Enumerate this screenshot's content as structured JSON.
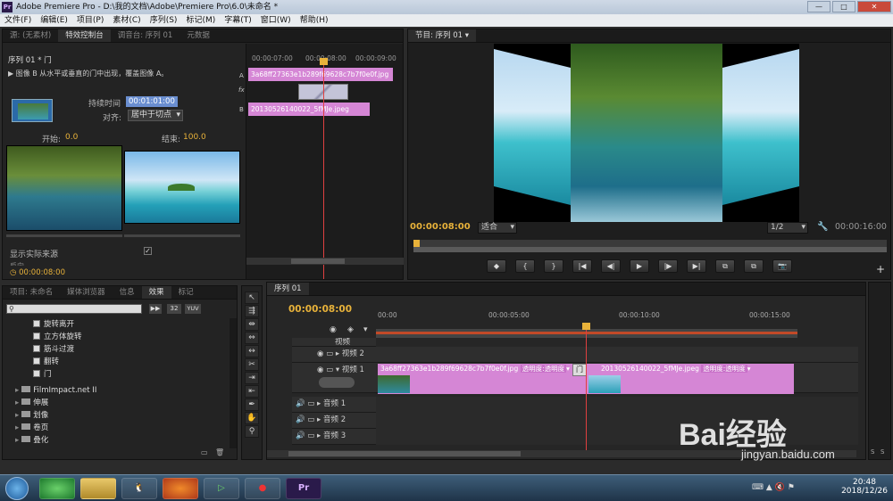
{
  "window": {
    "title": "Adobe Premiere Pro - D:\\我的文档\\Adobe\\Premiere Pro\\6.0\\未命名 *",
    "logo": "Pr",
    "buttons": [
      "—",
      "□",
      "✕"
    ]
  },
  "menu": [
    "文件(F)",
    "编辑(E)",
    "项目(P)",
    "素材(C)",
    "序列(S)",
    "标记(M)",
    "字幕(T)",
    "窗口(W)",
    "帮助(H)"
  ],
  "effect_controls": {
    "tabs": [
      "源: (无素材)",
      "特效控制台",
      "调音台: 序列 01",
      "元数据"
    ],
    "active_tab": "特效控制台",
    "sequence_label": "序列 01 * 门",
    "description": "图像 B 从水平或垂直的门中出现，覆盖图像 A。",
    "duration_label": "持续时间",
    "duration_value": "00:01:01:00",
    "align_label": "对齐:",
    "align_value": "居中于切点",
    "start_label": "开始:",
    "start_value": "0.0",
    "end_label": "结束:",
    "end_value": "100.0",
    "show_source_label": "显示实际来源",
    "current_time": "00:00:08:00",
    "mini_ruler": [
      "00:00:07:00",
      "00:00:08:00",
      "00:00:09:00"
    ],
    "clip_a": "3a68ff27363e1b289f69628c7b7f0e0f.jpg",
    "clip_b": "20130526140022_5fMJe.jpeg",
    "track_a": "A",
    "track_b": "B",
    "fx_label": "fx",
    "reverse_label": "反向"
  },
  "program_monitor": {
    "tab": "节目: 序列 01",
    "current_time": "00:00:08:00",
    "fit": "适合",
    "quality": "1/2",
    "duration": "00:00:16:00",
    "controls": [
      "◆",
      "{",
      "}",
      "|◀",
      "◀|",
      "▶",
      "|▶",
      "▶|",
      "⧉",
      "⧉",
      "📷"
    ]
  },
  "project_panel": {
    "tabs": [
      "项目: 未命名",
      "媒体浏览器",
      "信息",
      "效果",
      "标记"
    ],
    "active_tab": "效果",
    "search_placeholder": "",
    "badges": [
      "32",
      "YUV"
    ],
    "effects": [
      "旋转离开",
      "立方体旋转",
      "筋斗过渡",
      "翻转",
      "门"
    ],
    "folders": [
      "FilmImpact.net II",
      "伸展",
      "划像",
      "卷页",
      "叠化"
    ]
  },
  "timeline": {
    "tab": "序列 01",
    "current_time": "00:00:08:00",
    "ruler": [
      "00:00",
      "00:00:05:00",
      "00:00:10:00",
      "00:00:15:00"
    ],
    "tracks": {
      "hidden_top": "视频",
      "video2": "视频 2",
      "video1": "视频 1",
      "audio1": "音频 1",
      "audio2": "音频 2",
      "audio3": "音频 3"
    },
    "clip1_label": "3a68ff27363e1b289f69628c7b7f0e0f.jpg",
    "clip1_fx": "透明度:透明度",
    "clip2_label": "20130526140022_5fMJe.jpeg",
    "clip2_fx": "透明度:透明度",
    "transition_icon": "门",
    "ss_buttons": [
      "S",
      "S"
    ]
  },
  "taskbar": {
    "clock_time": "20:48",
    "clock_date": "2018/12/26",
    "app_icons": [
      "start-orb",
      "360-icon",
      "explorer-icon",
      "qq-icon",
      "firefox-icon",
      "camtasia-icon",
      "recorder-icon",
      "premiere-icon"
    ]
  },
  "watermark": {
    "brand": "Bai经验",
    "url": "jingyan.baidu.com"
  },
  "colors": {
    "accent_yellow": "#e8b23a",
    "clip_pink": "#d586d5",
    "panel_bg": "#232323",
    "playhead": "#e04040"
  }
}
